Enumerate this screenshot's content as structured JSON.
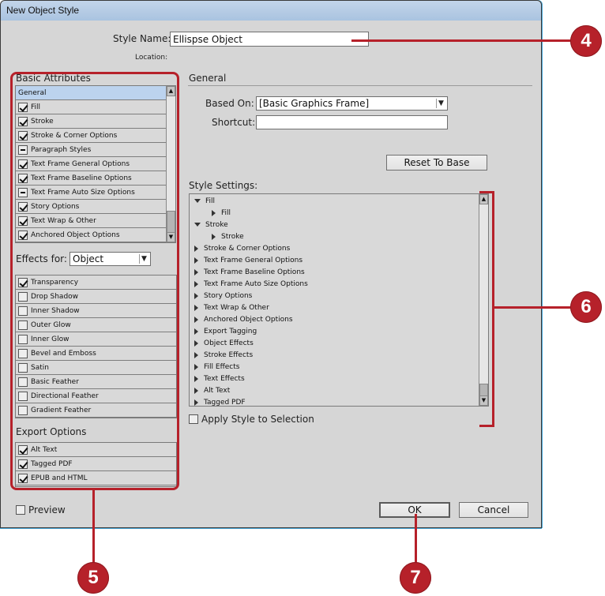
{
  "window": {
    "title": "New Object Style"
  },
  "style_name": {
    "label": "Style Name:",
    "value": "Ellispse Object"
  },
  "location": {
    "label": "Location:"
  },
  "basic_attributes": {
    "heading": "Basic Attributes",
    "items": [
      {
        "label": "General",
        "state": "none",
        "selected": true
      },
      {
        "label": "Fill",
        "state": "checked"
      },
      {
        "label": "Stroke",
        "state": "checked"
      },
      {
        "label": "Stroke & Corner Options",
        "state": "checked"
      },
      {
        "label": "Paragraph Styles",
        "state": "mixed"
      },
      {
        "label": "Text Frame General Options",
        "state": "checked"
      },
      {
        "label": "Text Frame Baseline Options",
        "state": "checked"
      },
      {
        "label": "Text Frame Auto Size Options",
        "state": "mixed"
      },
      {
        "label": "Story Options",
        "state": "checked"
      },
      {
        "label": "Text Wrap & Other",
        "state": "checked"
      },
      {
        "label": "Anchored Object Options",
        "state": "checked"
      }
    ]
  },
  "effects_for": {
    "label": "Effects for:",
    "value": "Object",
    "items": [
      {
        "label": "Transparency",
        "state": "checked"
      },
      {
        "label": "Drop Shadow",
        "state": "unchecked"
      },
      {
        "label": "Inner Shadow",
        "state": "unchecked"
      },
      {
        "label": "Outer Glow",
        "state": "unchecked"
      },
      {
        "label": "Inner Glow",
        "state": "unchecked"
      },
      {
        "label": "Bevel and Emboss",
        "state": "unchecked"
      },
      {
        "label": "Satin",
        "state": "unchecked"
      },
      {
        "label": "Basic Feather",
        "state": "unchecked"
      },
      {
        "label": "Directional Feather",
        "state": "unchecked"
      },
      {
        "label": "Gradient Feather",
        "state": "unchecked"
      }
    ]
  },
  "export_options": {
    "heading": "Export Options",
    "items": [
      {
        "label": "Alt Text",
        "state": "checked"
      },
      {
        "label": "Tagged PDF",
        "state": "checked"
      },
      {
        "label": "EPUB and HTML",
        "state": "checked"
      }
    ]
  },
  "general": {
    "heading": "General",
    "based_on_label": "Based On:",
    "based_on_value": "[Basic Graphics Frame]",
    "shortcut_label": "Shortcut:",
    "shortcut_value": "",
    "reset_button": "Reset To Base"
  },
  "style_settings": {
    "heading": "Style Settings:",
    "items": [
      {
        "label": "Fill",
        "level": 0,
        "expanded": true
      },
      {
        "label": "Fill",
        "level": 1,
        "expanded": false
      },
      {
        "label": "Stroke",
        "level": 0,
        "expanded": true
      },
      {
        "label": "Stroke",
        "level": 1,
        "expanded": false
      },
      {
        "label": "Stroke & Corner Options",
        "level": 0,
        "expanded": false
      },
      {
        "label": "Text Frame General Options",
        "level": 0,
        "expanded": false
      },
      {
        "label": "Text Frame Baseline Options",
        "level": 0,
        "expanded": false
      },
      {
        "label": "Text Frame Auto Size Options",
        "level": 0,
        "expanded": false
      },
      {
        "label": "Story Options",
        "level": 0,
        "expanded": false
      },
      {
        "label": "Text Wrap & Other",
        "level": 0,
        "expanded": false
      },
      {
        "label": "Anchored Object Options",
        "level": 0,
        "expanded": false
      },
      {
        "label": "Export Tagging",
        "level": 0,
        "expanded": false
      },
      {
        "label": "Object Effects",
        "level": 0,
        "expanded": false
      },
      {
        "label": "Stroke Effects",
        "level": 0,
        "expanded": false
      },
      {
        "label": "Fill Effects",
        "level": 0,
        "expanded": false
      },
      {
        "label": "Text Effects",
        "level": 0,
        "expanded": false
      },
      {
        "label": " Alt Text",
        "level": 0,
        "expanded": false
      },
      {
        "label": " Tagged PDF",
        "level": 0,
        "expanded": false
      }
    ]
  },
  "apply_style": {
    "label": "Apply Style to Selection",
    "checked": false
  },
  "preview": {
    "label": "Preview",
    "checked": false
  },
  "buttons": {
    "ok": "OK",
    "cancel": "Cancel"
  },
  "callouts": {
    "c4": "4",
    "c5": "5",
    "c6": "6",
    "c7": "7",
    "color": "#b6212a"
  }
}
